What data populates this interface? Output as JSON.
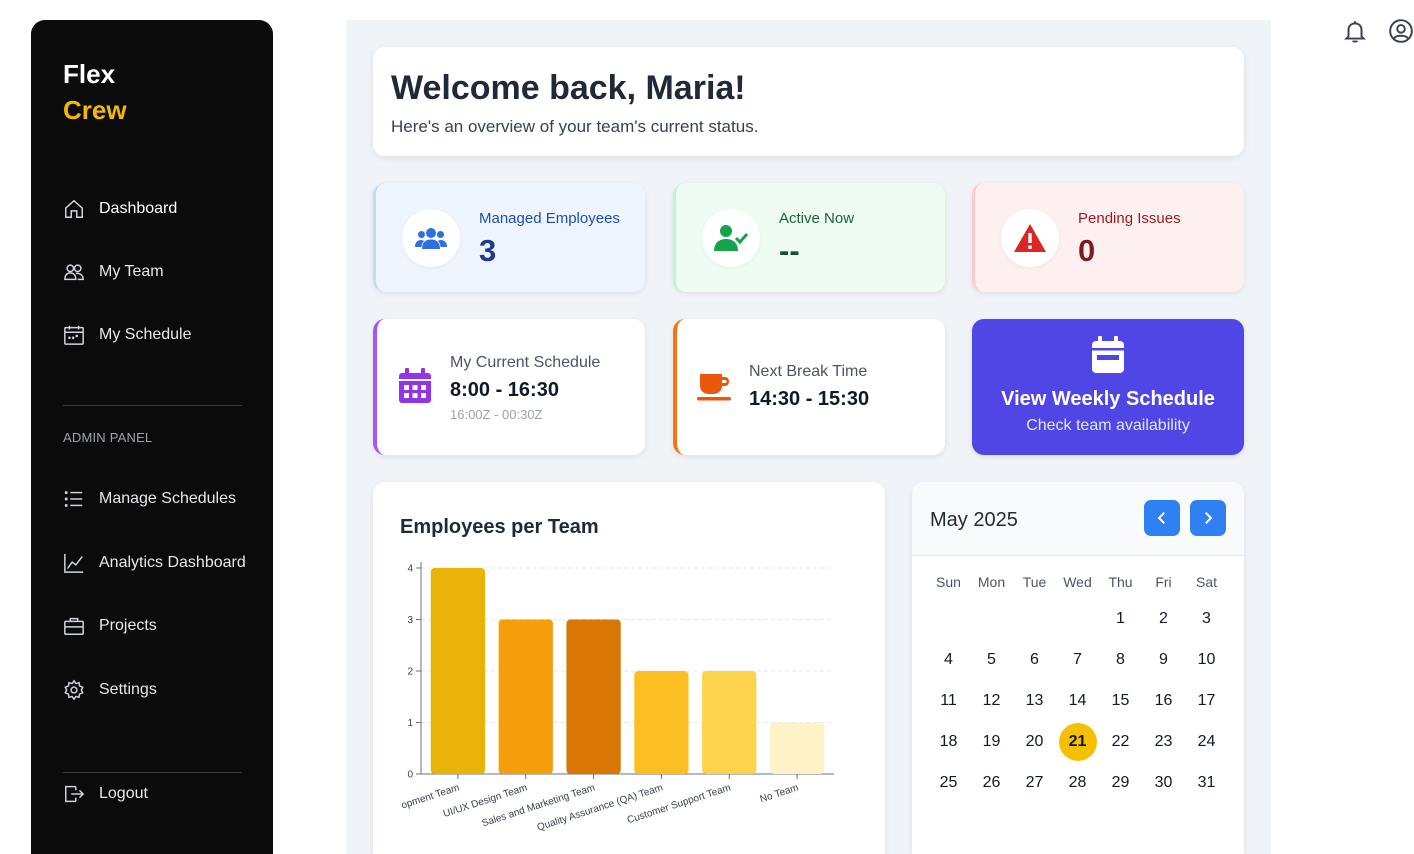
{
  "brand": {
    "line1": "Flex",
    "line2": "Crew"
  },
  "nav": {
    "dashboard": "Dashboard",
    "my_team": "My Team",
    "my_schedule": "My Schedule",
    "admin_label": "ADMIN PANEL",
    "manage_schedules": "Manage Schedules",
    "analytics": "Analytics Dashboard",
    "projects": "Projects",
    "settings": "Settings",
    "logout": "Logout"
  },
  "welcome": {
    "title": "Welcome back, Maria!",
    "subtitle": "Here's an overview of your team's current status."
  },
  "stats": {
    "managed": {
      "label": "Managed Employees",
      "value": "3"
    },
    "active": {
      "label": "Active Now",
      "value": "--"
    },
    "pending": {
      "label": "Pending Issues",
      "value": "0"
    }
  },
  "schedule": {
    "label": "My Current Schedule",
    "time": "8:00 - 16:30",
    "utc": "16:00Z - 00:30Z"
  },
  "break": {
    "label": "Next Break Time",
    "time": "14:30 - 15:30"
  },
  "weekly": {
    "title": "View Weekly Schedule",
    "subtitle": "Check team availability"
  },
  "chart_card": {
    "title": "Employees per Team"
  },
  "chart_data": {
    "type": "bar",
    "title": "Employees per Team",
    "categories": [
      "Development Team",
      "UI/UX Design Team",
      "Sales and Marketing Team",
      "Quality Assurance (QA) Team",
      "Customer Support Team",
      "No Team"
    ],
    "category_labels_visible": [
      "opment Team",
      "UI/UX Design Team",
      "Sales and Marketing Team",
      "Quality Assurance (QA) Team",
      "Customer Support Team",
      "No Team"
    ],
    "values": [
      4,
      3,
      3,
      2,
      2,
      1
    ],
    "colors": [
      "#eab308",
      "#f59e0b",
      "#d97706",
      "#fbbf24",
      "#fcd34d",
      "#fef3c7"
    ],
    "ylim": [
      0,
      4
    ],
    "yticks": [
      "0",
      "1",
      "2",
      "3",
      "4"
    ],
    "grid": true,
    "xlabel": "",
    "ylabel": ""
  },
  "calendar": {
    "title": "May 2025",
    "weekdays": [
      "Sun",
      "Mon",
      "Tue",
      "Wed",
      "Thu",
      "Fri",
      "Sat"
    ],
    "leading_blanks": 4,
    "days": [
      "1",
      "2",
      "3",
      "4",
      "5",
      "6",
      "7",
      "8",
      "9",
      "10",
      "11",
      "12",
      "13",
      "14",
      "15",
      "16",
      "17",
      "18",
      "19",
      "20",
      "21",
      "22",
      "23",
      "24",
      "25",
      "26",
      "27",
      "28",
      "29",
      "30",
      "31"
    ],
    "today": "21"
  },
  "colors": {
    "accent": "#4f46e5",
    "brand_yellow": "#f5b800",
    "managed_bg": "#eef5ff",
    "active_bg": "#eefcf3",
    "pending_bg": "#fef0f0"
  }
}
